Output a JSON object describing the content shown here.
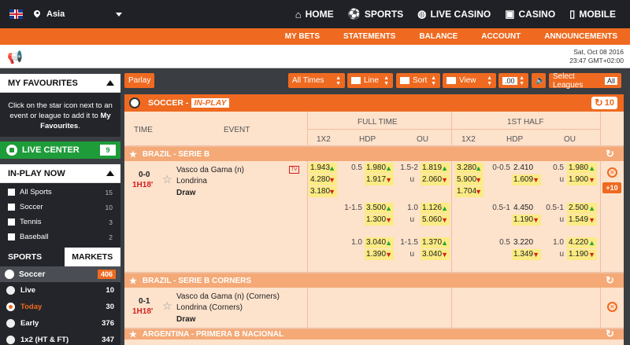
{
  "header": {
    "region": "Asia",
    "nav": [
      {
        "label": "HOME",
        "icon": "home-icon"
      },
      {
        "label": "SPORTS",
        "icon": "player-icon"
      },
      {
        "label": "LIVE CASINO",
        "icon": "globe-icon"
      },
      {
        "label": "CASINO",
        "icon": "gamepad-icon"
      },
      {
        "label": "MOBILE",
        "icon": "phone-icon"
      }
    ]
  },
  "subnav": [
    "MY BETS",
    "STATEMENTS",
    "BALANCE",
    "ACCOUNT",
    "ANNOUNCEMENTS"
  ],
  "datetime": {
    "date": "Sat, Oct 08 2016",
    "time": "23:47 GMT+02:00"
  },
  "sidebar": {
    "favourites_title": "MY FAVOURITES",
    "fav_text_1": "Click on the star icon next to an event or league to add it to ",
    "fav_text_bold": "My Favourites",
    "fav_text_end": ".",
    "live_center": "LIVE CENTER",
    "live_center_count": "9",
    "inplay_title": "IN-PLAY NOW",
    "inplay_items": [
      {
        "label": "All Sports",
        "count": "15"
      },
      {
        "label": "Soccer",
        "count": "10"
      },
      {
        "label": "Tennis",
        "count": "3"
      },
      {
        "label": "Baseball",
        "count": "2"
      }
    ],
    "tab_sports": "SPORTS",
    "tab_markets": "MARKETS",
    "sport": {
      "label": "Soccer",
      "count": "406"
    },
    "markets": [
      {
        "label": "Live",
        "count": "10"
      },
      {
        "label": "Today",
        "count": "30"
      },
      {
        "label": "Early",
        "count": "376"
      },
      {
        "label": "1x2 (HT & FT)",
        "count": "347"
      }
    ]
  },
  "toolbar": {
    "parlay": "Parlay",
    "all_times": "All Times",
    "line": "Line",
    "sort": "Sort",
    "view": "View",
    "odds_format": ".00",
    "select_leagues": "Select Leagues",
    "all": "All"
  },
  "section": {
    "title": "SOCCER -",
    "status": "IN-PLAY",
    "refresh_count": "10"
  },
  "columns": {
    "time": "TIME",
    "event": "EVENT",
    "full_time": "FULL TIME",
    "first_half": "1ST HALF",
    "c1x2": "1X2",
    "hdp": "HDP",
    "ou": "OU",
    "h1x2": "1X2",
    "hhdp": "HDP",
    "hou": "OU"
  },
  "leagues": [
    {
      "name": "BRAZIL - SERIE B"
    },
    {
      "name": "BRAZIL - SERIE B CORNERS"
    },
    {
      "name": "ARGENTINA - PRIMERA B NACIONAL"
    }
  ],
  "match1": {
    "score": "0-0",
    "time": "1H18'",
    "home": "Vasco da Gama (n)",
    "away": "Londrina",
    "draw": "Draw",
    "more": "+10",
    "ft_1x2": [
      "1.943",
      "4.280",
      "3.180"
    ],
    "rows": [
      {
        "hdp_line": "0.5",
        "hdp_home": "1.980",
        "hdp_away": "1.917",
        "ou_line": "1.5-2",
        "ou_u": "u",
        "ou_over": "1.819",
        "ou_under": "2.060",
        "h1x2": [
          "3.280",
          "5.900",
          "1.704"
        ],
        "hhdp_line": "0-0.5",
        "hhdp_home": "2.410",
        "hhdp_away": "1.609",
        "hou_line": "0.5",
        "hou_u": "u",
        "hou_over": "1.980",
        "hou_under": "1.900"
      },
      {
        "hdp_line": "1-1.5",
        "hdp_home": "3.500",
        "hdp_away": "1.300",
        "ou_line": "1.0",
        "ou_u": "u",
        "ou_over": "1.126",
        "ou_under": "5.060",
        "hhdp_line": "0.5-1",
        "hhdp_home": "4.450",
        "hhdp_away": "1.190",
        "hou_line": "0.5-1",
        "hou_u": "u",
        "hou_over": "2.500",
        "hou_under": "1.549"
      },
      {
        "hdp_line": "1.0",
        "hdp_home": "3.040",
        "hdp_away": "1.390",
        "ou_line": "1-1.5",
        "ou_u": "u",
        "ou_over": "1.370",
        "ou_under": "3.040",
        "hhdp_line": "0.5",
        "hhdp_home": "3.220",
        "hhdp_away": "1.349",
        "hou_line": "1.0",
        "hou_u": "u",
        "hou_over": "4.220",
        "hou_under": "1.190"
      }
    ]
  },
  "match2": {
    "score": "0-1",
    "time": "1H18'",
    "home": "Vasco da Gama (n) (Corners)",
    "away": "Londrina (Corners)",
    "draw": "Draw"
  }
}
